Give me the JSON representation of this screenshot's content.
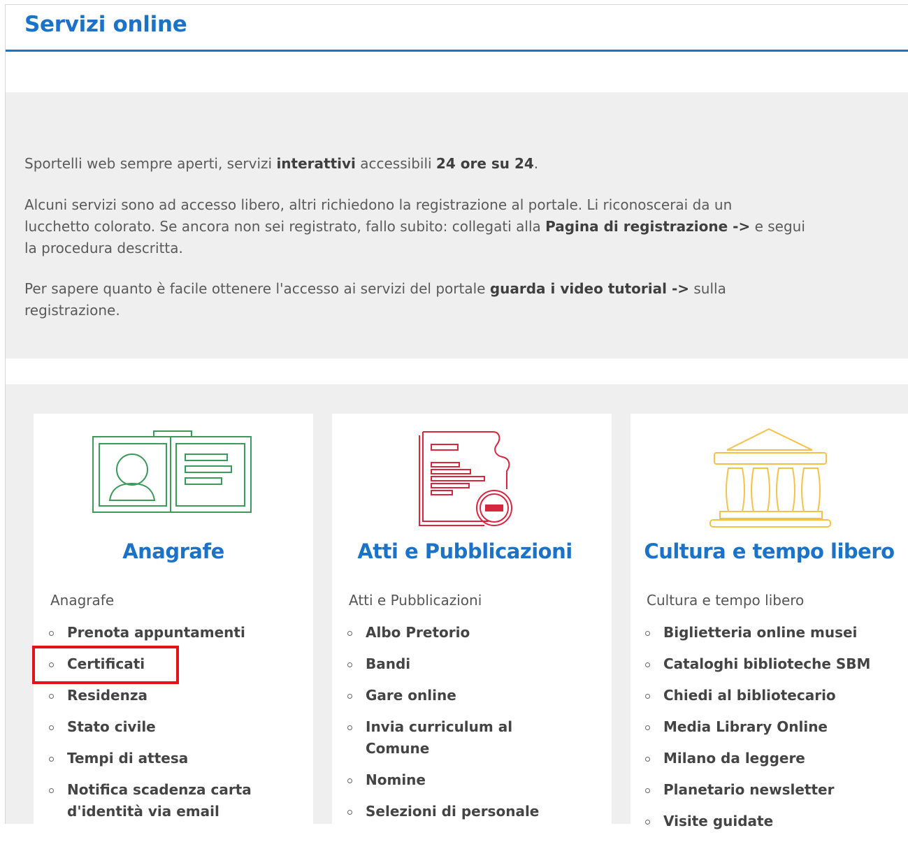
{
  "header": {
    "title": "Servizi online"
  },
  "intro": {
    "p1": {
      "t1": "Sportelli web sempre aperti, servizi ",
      "b1": "interattivi",
      "t2": " accessibili ",
      "b2": "24 ore su 24",
      "t3": "."
    },
    "p2": {
      "line1": "Alcuni servizi sono ad accesso libero, altri richiedono la registrazione al portale. Li riconoscerai da un",
      "line2_pre": "lucchetto colorato. Se ancora non sei registrato, fallo subito: collegati alla ",
      "line2_link": "Pagina di registrazione ->",
      "line2_post": " e segui",
      "line3": "la procedura descritta."
    },
    "p3": {
      "t1": "Per sapere quanto è facile ottenere l'accesso ai servizi del portale ",
      "link": "guarda i video tutorial ->",
      "t2": " sulla",
      "line2": "registrazione."
    }
  },
  "cards": [
    {
      "title": "Anagrafe",
      "subtitle": "Anagrafe",
      "icon": "id-card-icon",
      "color": "#3d9a5b",
      "items": [
        "Prenota appuntamenti",
        "Certificati",
        "Residenza",
        "Stato civile",
        "Tempi di attesa",
        "Notifica scadenza carta",
        "d'identità via email"
      ]
    },
    {
      "title": "Atti e Pubblicazioni",
      "subtitle": "Atti e Pubblicazioni",
      "icon": "document-icon",
      "color": "#d9263f",
      "items": [
        "Albo Pretorio",
        "Bandi",
        "Gare online",
        "Invia curriculum al",
        "Comune",
        "Nomine",
        "Selezioni di personale"
      ]
    },
    {
      "title": "Cultura e tempo libero",
      "subtitle": "Cultura e tempo libero",
      "icon": "museum-icon",
      "color": "#f2c24a",
      "items": [
        "Biglietteria online musei",
        "Cataloghi biblioteche SBM",
        "Chiedi al bibliotecario",
        "Media Library Online",
        "Milano da leggere",
        "Planetario newsletter",
        "Visite guidate"
      ]
    }
  ],
  "highlight": {
    "color": "#e3131b",
    "target": "Certificati"
  },
  "accent_color": "#1a73c8"
}
